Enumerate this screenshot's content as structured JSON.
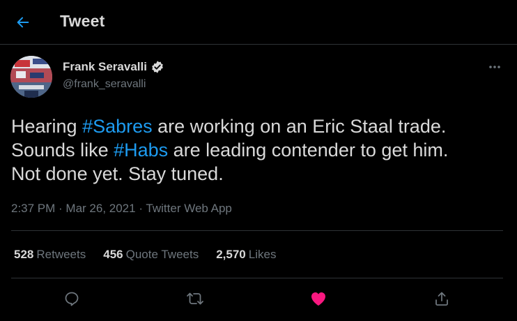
{
  "header": {
    "title": "Tweet",
    "back_icon": "arrow-left-icon"
  },
  "author": {
    "name": "Frank Seravalli",
    "handle": "@frank_seravalli",
    "verified": true
  },
  "tweet": {
    "line1_pre": "Hearing ",
    "line1_tag": "#Sabres",
    "line1_post": " are working on an Eric Staal trade.",
    "line2_pre": "Sounds like ",
    "line2_tag": "#Habs",
    "line2_post": " are leading contender to get him.",
    "line3": "Not done yet. Stay tuned.",
    "time": "2:37 PM",
    "date": "Mar 26, 2021",
    "separator": " · ",
    "source": "Twitter Web App"
  },
  "stats": {
    "retweets_count": "528",
    "retweets_label": "Retweets",
    "quotes_count": "456",
    "quotes_label": "Quote Tweets",
    "likes_count": "2,570",
    "likes_label": "Likes"
  },
  "actions": {
    "reply_icon": "reply-icon",
    "retweet_icon": "retweet-icon",
    "like_icon": "heart-filled-icon",
    "share_icon": "share-icon",
    "liked": true
  },
  "colors": {
    "background": "#000000",
    "accent": "#1d9bf0",
    "like": "#f91880",
    "text": "#d9d9d9",
    "secondary": "#6e767d",
    "border": "#2f3336"
  }
}
